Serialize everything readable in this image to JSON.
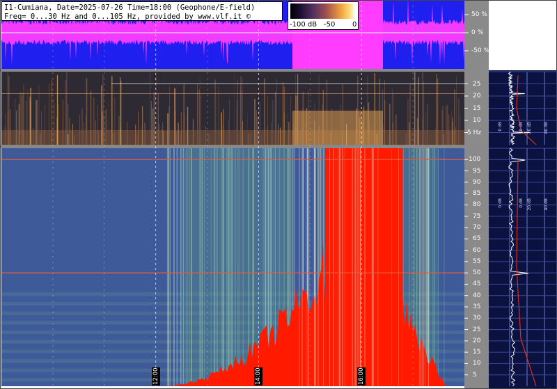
{
  "header": {
    "line1": "I1-Cumiana, Date=2025-07-26 Time=18:00 (Geophone/E-field)",
    "line2": "Freq= 0...30 Hz and 0...105 Hz, provided by www.vlf.it ©"
  },
  "colorbar": {
    "labels": [
      "-100 dB",
      "-50",
      "0"
    ]
  },
  "colors": {
    "waveform_bg": "#1f1ff0",
    "waveform_trace": "#ff3cff",
    "lowband_bg": "#2e2a34",
    "highband_bg": "#3f5a98",
    "saturation": "#ff1a00",
    "side_bg": "#0c1240",
    "grid": "#ffffff"
  },
  "chart_data": [
    {
      "type": "line",
      "panel": "waveform",
      "title": "",
      "yaxis_ticks": [
        "50 %",
        "0 %",
        "-50 %"
      ],
      "ylim": [
        -100,
        100
      ],
      "yunit": "%"
    },
    {
      "type": "heatmap",
      "panel": "low-frequency spectrogram",
      "ytick_labels": [
        "25",
        "20",
        "15",
        "10",
        "5 Hz"
      ],
      "ylim": [
        0,
        30
      ],
      "yunit": "Hz",
      "colorscale_db": [
        -100,
        0
      ],
      "side_spectrum_labels": [
        "0 dB",
        "0 dB",
        "20 dB",
        "40 dB"
      ],
      "notable_lines_hz": [
        5,
        21
      ]
    },
    {
      "type": "heatmap",
      "panel": "high-frequency spectrogram",
      "ytick_labels": [
        "100",
        "95",
        "90",
        "85",
        "80",
        "75",
        "70",
        "65",
        "60",
        "55",
        "50",
        "45",
        "40",
        "35",
        "30",
        "25",
        "20",
        "15",
        "10",
        "5"
      ],
      "ylim": [
        0,
        105
      ],
      "yunit": "Hz",
      "colorscale_db": [
        -100,
        0
      ],
      "side_spectrum_labels": [
        "0 dB",
        "0 dB",
        "20 dB",
        "40 dB"
      ],
      "notable_lines_hz": [
        50,
        100
      ],
      "saturated_interval_hours": [
        15.3,
        16.8
      ]
    }
  ],
  "time_axis": {
    "labels": [
      "12:00",
      "14:00",
      "16:00"
    ],
    "hours": [
      12,
      14,
      16
    ],
    "range_hours": [
      9,
      18
    ]
  }
}
